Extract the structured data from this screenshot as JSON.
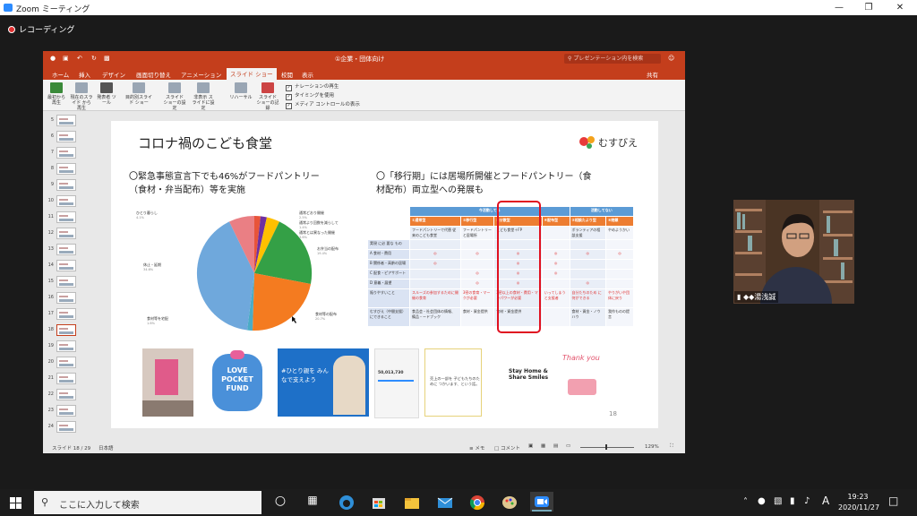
{
  "zoom": {
    "title": "Zoom ミーティング",
    "recording": "レコーディング"
  },
  "ppt": {
    "filename": "①企業・団体向け",
    "search_placeholder": "プレゼンテーション内を検索",
    "tabs": [
      "ホーム",
      "挿入",
      "デザイン",
      "画面切り替え",
      "アニメーション",
      "スライド ショー",
      "校閲",
      "表示"
    ],
    "share": "共有",
    "ribbon_buttons": [
      {
        "label": "最初から 再生",
        "icon": "play-from-start-icon"
      },
      {
        "label": "現在のスライド から再生",
        "icon": "play-current-icon"
      },
      {
        "label": "発表者 ツール",
        "icon": "presenter-icon"
      },
      {
        "label": "目的別スライド ショー",
        "icon": "custom-show-icon"
      },
      {
        "label": "スライド ショーの設定",
        "icon": "setup-icon"
      },
      {
        "label": "非表示 スライドに設定",
        "icon": "hide-slide-icon"
      },
      {
        "label": "リハーサル",
        "icon": "rehearse-icon"
      },
      {
        "label": "スライド ショーの記録",
        "icon": "record-icon"
      }
    ],
    "checkboxes": [
      "ナレーションの再生",
      "タイミングを使用",
      "メディア コントロールの表示"
    ],
    "thumb_numbers": [
      "5",
      "6",
      "7",
      "8",
      "9",
      "10",
      "11",
      "12",
      "13",
      "14",
      "15",
      "16",
      "17",
      "18",
      "19",
      "20",
      "21",
      "22",
      "23",
      "24"
    ],
    "status": {
      "slide": "スライド 18 / 29",
      "lang": "日本語",
      "notes": "メモ",
      "comments": "コメント",
      "zoom": "129%"
    }
  },
  "slide": {
    "title": "コロナ禍のこども食堂",
    "logo": "むすびえ",
    "left_head_1": "〇緊急事態宣言下でも46%がフードパントリー",
    "left_head_2": "（食材・弁当配布）等を実施",
    "right_head_1": "〇「移行期」には居場所開催とフードパントリー（食",
    "right_head_2": "材配布）両立型への発展も",
    "page": "18",
    "pie_labels": [
      {
        "text": "通常どおり開催",
        "pct": "2.5%"
      },
      {
        "text": "通常より回数を減らして",
        "pct": "1.4%"
      },
      {
        "text": "通常とは異なった開催",
        "pct": "3.6%"
      },
      {
        "text": "お弁当の配布",
        "pct": "19.4%"
      },
      {
        "text": "食材等の配布",
        "pct": "20.7%"
      },
      {
        "text": "食材等を宅配",
        "pct": "1.6%"
      },
      {
        "text": "休止・延期",
        "pct": "34.6%"
      },
      {
        "text": "ひとり暮らし",
        "pct": "4.1%"
      }
    ],
    "table": {
      "band_left": "今活動してる",
      "band_right": "活動してない",
      "cols": [
        "①通常型",
        "②移行型",
        "③分散型",
        "④配布型",
        "⑤相談たより型",
        "⑥閉鎖"
      ],
      "col_sub": [
        "フードパントリーで代替 従来のこども食堂",
        "フードパントリーと居場所",
        "こども食堂＋FP",
        "",
        "ボランティアの相談支援",
        "やめようかい"
      ],
      "rows": [
        {
          "label": "実現 に必 要な もの",
          "cells": [
            "",
            "",
            "",
            "",
            "",
            ""
          ]
        },
        {
          "label": "A 食材・費用",
          "cells": [
            "◎",
            "◎",
            "◎",
            "◎",
            "◎",
            "◎"
          ]
        },
        {
          "label": "B 関係者・高齢の居場",
          "cells": [
            "◎",
            "",
            "◎",
            "◎",
            "",
            ""
          ]
        },
        {
          "label": "C 配食・ピアサポート",
          "cells": [
            "",
            "◎",
            "◎",
            "◎",
            "",
            ""
          ]
        },
        {
          "label": "D 意義・展望",
          "cells": [
            "",
            "◎",
            "◎",
            "",
            "◎",
            ""
          ]
        },
        {
          "label": "陥りやすいこと",
          "cells": [
            "スルーズの参加するために開催の食育",
            "3密の食育・マークが必要",
            "3密以上の食材・費用・マンパワーが必要",
            "いってしまうと支援者",
            "自分たちのため に何ができる",
            "やりがいや団体に戻り"
          ]
        },
        {
          "label": "むすびえ（中間支援）にできること",
          "cells": [
            "食品会・社会団体の情報、備品・ードブック",
            "食材・資金提供",
            "食材・資金提供",
            "",
            "食材・資金・ノウハウ",
            "我作ものの提言"
          ]
        }
      ]
    },
    "images": [
      {
        "name": "poster-photo",
        "text": ""
      },
      {
        "name": "love-pocket-fund",
        "text": "LOVE POCKET FUND"
      },
      {
        "name": "campaign-banner",
        "text": "#ひとり親を みんなで支えよう"
      },
      {
        "name": "crowdfunding-page",
        "text": "50,013,730"
      },
      {
        "name": "message-card",
        "text": "売上の一部を 子どもたちのために つかいます、という話。"
      },
      {
        "name": "stay-home",
        "text": "Stay Home & Share Smiles"
      },
      {
        "name": "thank-you",
        "text": "Thank you"
      }
    ]
  },
  "video": {
    "name": "◆◆湯浅誠"
  },
  "taskbar": {
    "search": "ここに入力して検索",
    "time": "19:23",
    "date": "2020/11/27",
    "ime": "A"
  },
  "colors": {
    "ppt_accent": "#c43e1c",
    "zoom_blue": "#2d8cff",
    "table_blue": "#5b9bd5",
    "table_orange": "#ed7d31"
  }
}
